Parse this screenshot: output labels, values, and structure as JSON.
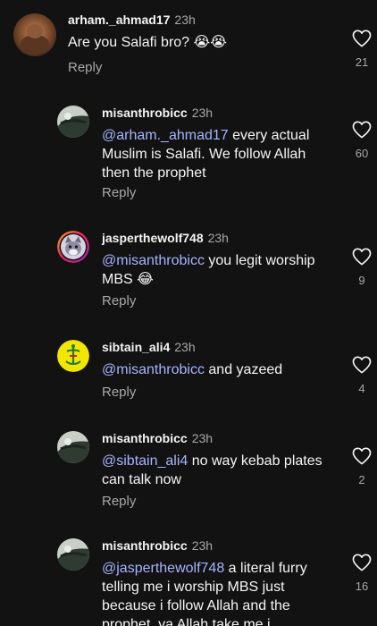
{
  "comments": [
    {
      "username": "arham._ahmad17",
      "time": "23h",
      "mention": "",
      "text": "Are you Salafi bro? 😭😭",
      "reply_label": "Reply",
      "likes": "21",
      "avatar_icon": "avatar-photo"
    },
    {
      "username": "misanthrobicc",
      "time": "23h",
      "mention": "@arham._ahmad17",
      "text": " every actual Muslim is Salafi. We follow Allah then the prophet",
      "reply_label": "Reply",
      "likes": "60",
      "avatar_icon": "avatar-photo"
    },
    {
      "username": "jasperthewolf748",
      "time": "23h",
      "mention": "@misanthrobicc",
      "text": " you legit worship MBS 😂",
      "reply_label": "Reply",
      "likes": "9",
      "avatar_icon": "avatar-wolf"
    },
    {
      "username": "sibtain_ali4",
      "time": "23h",
      "mention": "@misanthrobicc",
      "text": " and yazeed",
      "reply_label": "Reply",
      "likes": "4",
      "avatar_icon": "avatar-emblem"
    },
    {
      "username": "misanthrobicc",
      "time": "23h",
      "mention": "@sibtain_ali4",
      "text": " no way kebab plates can talk now",
      "reply_label": "Reply",
      "likes": "2",
      "avatar_icon": "avatar-photo"
    },
    {
      "username": "misanthrobicc",
      "time": "23h",
      "mention": "@jasperthewolf748",
      "text": " a literal furry telling me i worship MBS just because i follow Allah and the prophet, ya Allah take me i",
      "reply_label": "",
      "likes": "16",
      "avatar_icon": "avatar-photo"
    }
  ],
  "colors": {
    "background": "#121212",
    "mention": "#a6b4ff",
    "muted": "#a8a8a8"
  }
}
